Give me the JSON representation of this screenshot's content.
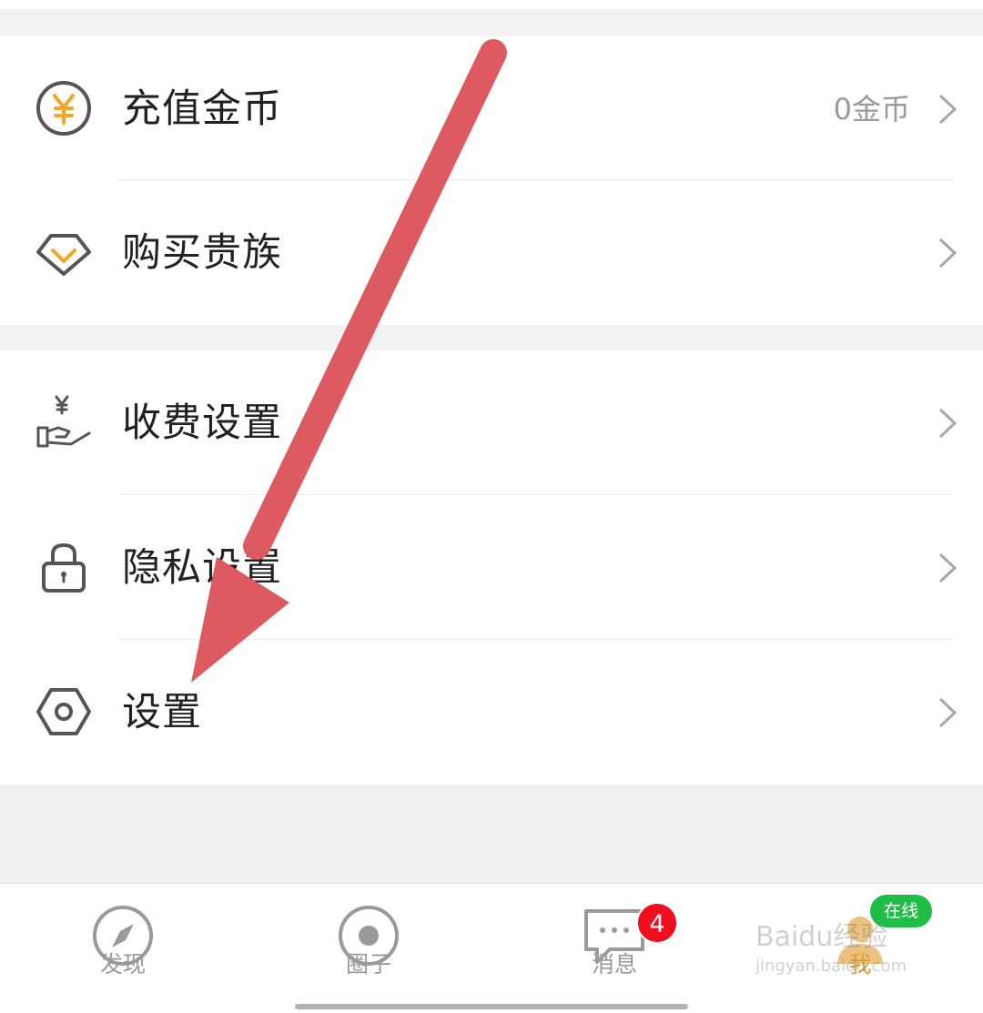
{
  "menu_group_1": [
    {
      "label": "充值金币",
      "value": "0金币",
      "icon": "coin-icon"
    },
    {
      "label": "购买贵族",
      "value": "",
      "icon": "diamond-icon"
    }
  ],
  "menu_group_2": [
    {
      "label": "收费设置",
      "icon": "hand-money-icon"
    },
    {
      "label": "隐私设置",
      "icon": "lock-icon"
    },
    {
      "label": "设置",
      "icon": "hexagon-gear-icon"
    }
  ],
  "tabbar": {
    "tabs": [
      {
        "label": "发现",
        "icon": "compass-icon"
      },
      {
        "label": "圈子",
        "icon": "circle-dot-icon"
      },
      {
        "label": "消息",
        "icon": "chat-bubble-icon",
        "badge": "4"
      },
      {
        "label": "我",
        "icon": "avatar-icon",
        "status": "在线"
      }
    ],
    "active_index": 3
  },
  "watermark": {
    "line1": "Baidu经验",
    "line2": "jingyan.baidu.com"
  },
  "colors": {
    "coin_accent": "#f5a623",
    "arrow": "#dc5a60",
    "badge_red": "#f00d1d",
    "online_green": "#1fbe46",
    "active_tab": "#d6a03c"
  }
}
